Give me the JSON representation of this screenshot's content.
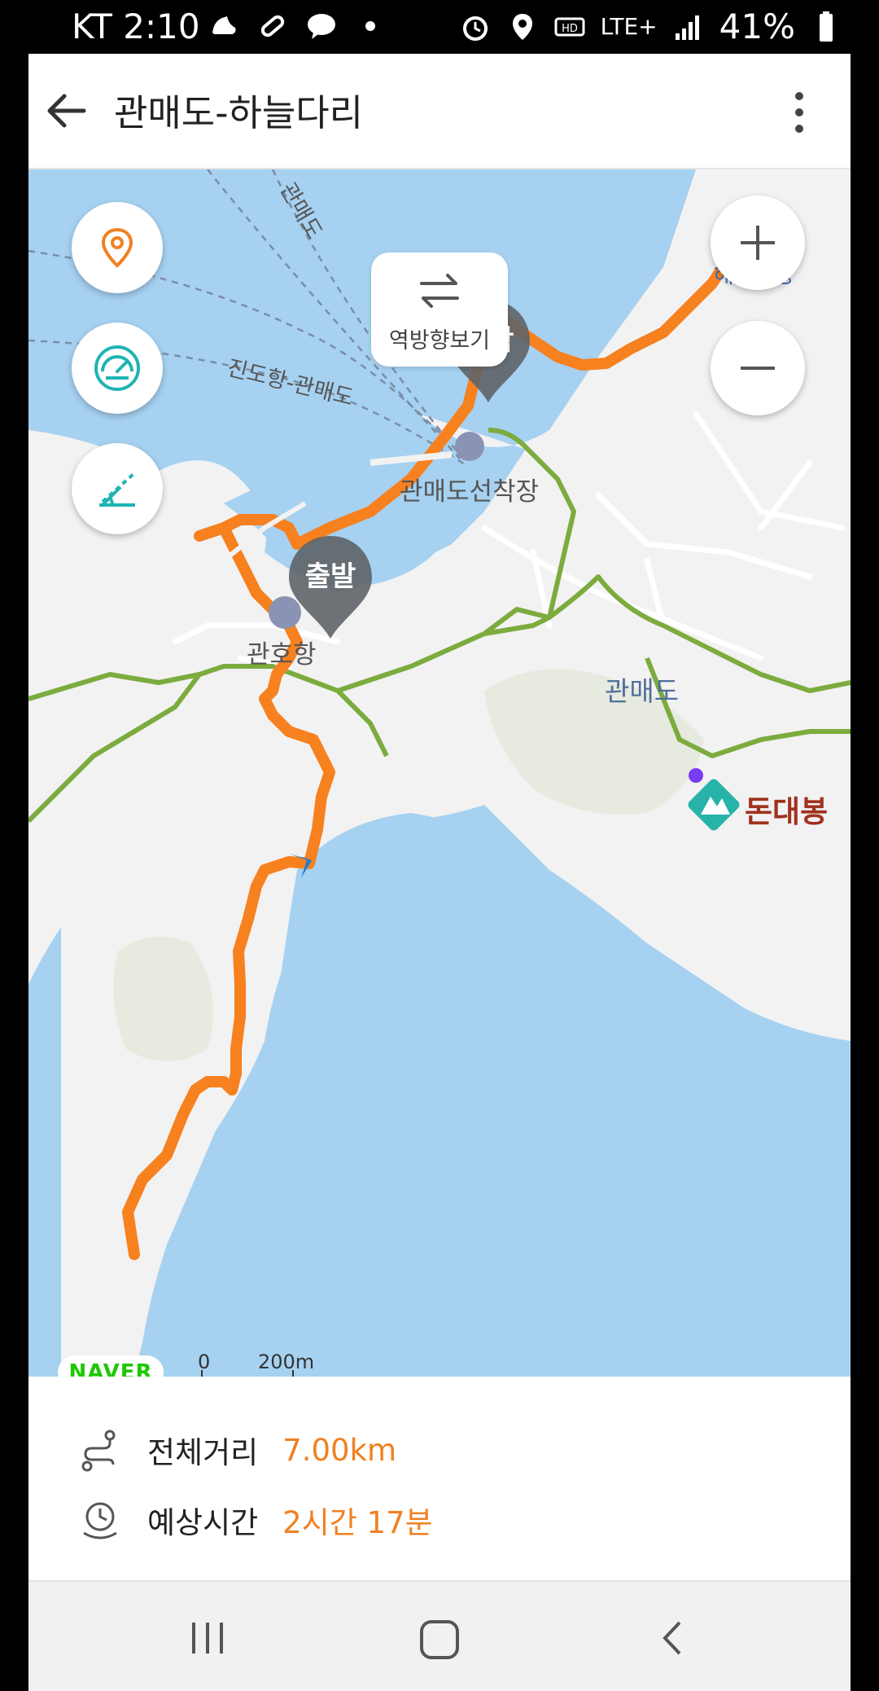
{
  "status_bar": {
    "carrier_time": "KT 2:10",
    "network": "LTE+",
    "battery": "41%"
  },
  "app_bar": {
    "title": "관매도-하늘다리"
  },
  "map": {
    "reverse_label": "역방향보기",
    "start_pin": "출발",
    "end_pin": "도착",
    "labels": {
      "ferry_route_1": "관매도",
      "ferry_route_2": "진도항-관매도",
      "pier": "관매도선착장",
      "port": "관호항",
      "island": "관매도",
      "peak": "돈대봉",
      "beach": "해수욕장"
    },
    "logo": "NAVER",
    "scale_zero": "0",
    "scale_distance": "200m"
  },
  "summary": {
    "distance_label": "전체거리",
    "distance_value": "7.00km",
    "time_label": "예상시간",
    "time_value": "2시간 17분"
  },
  "colors": {
    "route": "#f7801f",
    "trail": "#7cab3e",
    "water": "#a6d1f1",
    "land": "#f2f2f2",
    "accent_teal": "#1fb4b4",
    "accent_orange": "#f08122"
  }
}
